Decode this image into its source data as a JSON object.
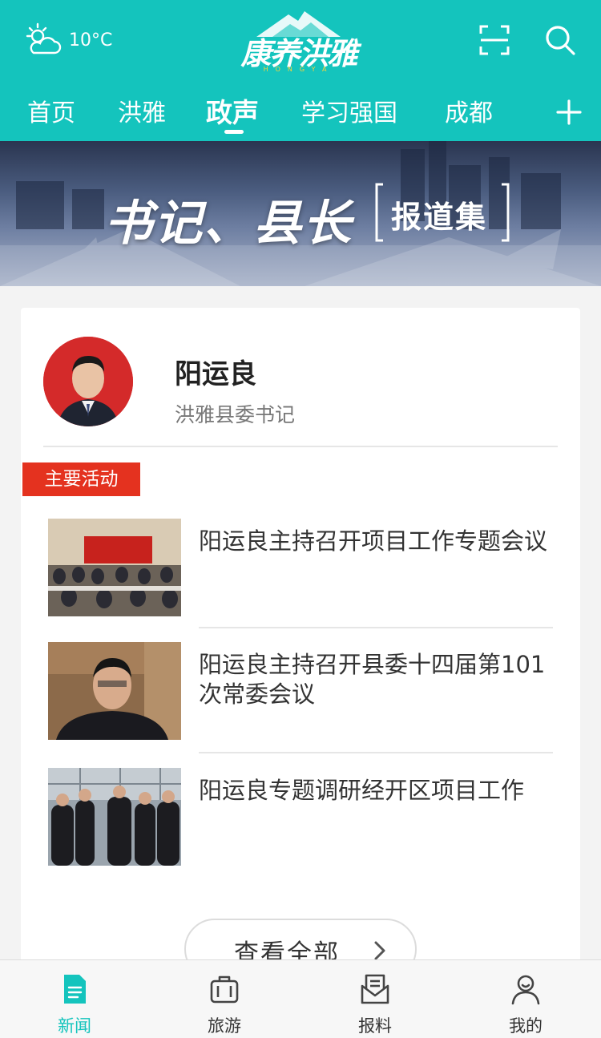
{
  "header": {
    "temperature": "10°C",
    "logo_text": "康养洪雅",
    "logo_sub": "HONGYA",
    "weather_icon": "partly-cloudy-icon",
    "scan_icon": "scan-icon",
    "search_icon": "search-icon",
    "accent_color": "#14c4bd"
  },
  "nav": {
    "tabs": [
      {
        "label": "首页"
      },
      {
        "label": "洪雅"
      },
      {
        "label": "政声",
        "active": true
      },
      {
        "label": "学习强国"
      },
      {
        "label": "成都"
      }
    ],
    "add_icon": "plus-icon"
  },
  "banner": {
    "title": "书记、县长",
    "subtitle": "报道集"
  },
  "profile": {
    "name": "阳运良",
    "title": "洪雅县委书记"
  },
  "section": {
    "tag": "主要活动",
    "tag_color": "#e4321f"
  },
  "news": [
    {
      "title": "阳运良主持召开项目工作专题会议"
    },
    {
      "title": "阳运良主持召开县委十四届第101次常委会议"
    },
    {
      "title": "阳运良专题调研经开区项目工作"
    }
  ],
  "view_all": {
    "label": "查看全部"
  },
  "tabbar": {
    "items": [
      {
        "label": "新闻",
        "icon": "news-icon",
        "active": true
      },
      {
        "label": "旅游",
        "icon": "suitcase-icon"
      },
      {
        "label": "报料",
        "icon": "report-mail-icon"
      },
      {
        "label": "我的",
        "icon": "user-icon"
      }
    ]
  }
}
